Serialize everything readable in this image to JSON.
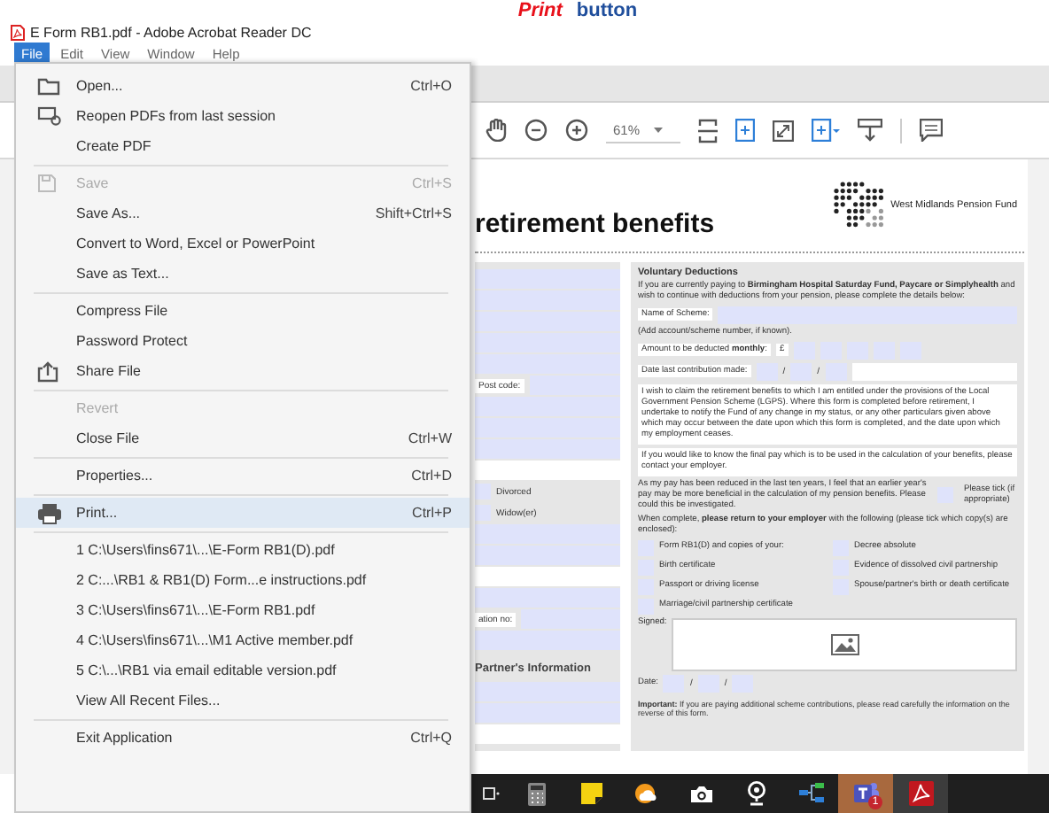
{
  "banner": [
    {
      "text": "Print",
      "kind": "emphasis"
    },
    {
      "text": "button",
      "kind": "plain"
    }
  ],
  "window": {
    "title": "E Form RB1.pdf - Adobe Acrobat Reader DC"
  },
  "menu_bar": [
    {
      "label": "File",
      "selected": true
    },
    {
      "label": "Edit",
      "selected": false
    },
    {
      "label": "View",
      "selected": false
    },
    {
      "label": "Window",
      "selected": false
    },
    {
      "label": "Help",
      "selected": false
    }
  ],
  "file_menu": [
    [
      {
        "label": "Open...",
        "shortcut": "Ctrl+O",
        "kind": "folder",
        "disabled": false,
        "highlighted": false
      },
      {
        "label": "Reopen PDFs from last session",
        "kind": "reopen",
        "disabled": false,
        "highlighted": false
      },
      {
        "label": "Create PDF",
        "disabled": false,
        "highlighted": false
      }
    ],
    [
      {
        "label": "Save",
        "shortcut": "Ctrl+S",
        "kind": "save",
        "disabled": true,
        "highlighted": false
      },
      {
        "label": "Save As...",
        "shortcut": "Shift+Ctrl+S",
        "disabled": false,
        "highlighted": false
      },
      {
        "label": "Convert to Word, Excel or PowerPoint",
        "disabled": false,
        "highlighted": false
      },
      {
        "label": "Save as Text...",
        "disabled": false,
        "highlighted": false
      }
    ],
    [
      {
        "label": "Compress File",
        "disabled": false,
        "highlighted": false
      },
      {
        "label": "Password Protect",
        "disabled": false,
        "highlighted": false
      },
      {
        "label": "Share File",
        "kind": "share",
        "disabled": false,
        "highlighted": false
      }
    ],
    [
      {
        "label": "Revert",
        "disabled": true,
        "highlighted": false
      },
      {
        "label": "Close File",
        "shortcut": "Ctrl+W",
        "disabled": false,
        "highlighted": false
      }
    ],
    [
      {
        "label": "Properties...",
        "shortcut": "Ctrl+D",
        "disabled": false,
        "highlighted": false
      }
    ],
    [
      {
        "label": "Print...",
        "shortcut": "Ctrl+P",
        "kind": "printer",
        "disabled": false,
        "highlighted": true
      }
    ],
    [
      {
        "label": "1 C:\\Users\\fins671\\...\\E-Form RB1(D).pdf",
        "disabled": false,
        "highlighted": false
      },
      {
        "label": "2 C:...\\RB1 & RB1(D) Form...e instructions.pdf",
        "disabled": false,
        "highlighted": false
      },
      {
        "label": "3 C:\\Users\\fins671\\...\\E-Form RB1.pdf",
        "disabled": false,
        "highlighted": false
      },
      {
        "label": "4 C:\\Users\\fins671\\...\\M1 Active member.pdf",
        "disabled": false,
        "highlighted": false
      },
      {
        "label": "5 C:\\...\\RB1 via email editable version.pdf",
        "disabled": false,
        "highlighted": false
      },
      {
        "label": "View All Recent Files...",
        "disabled": false,
        "highlighted": false
      }
    ],
    [
      {
        "label": "Exit Application",
        "shortcut": "Ctrl+Q",
        "disabled": false,
        "highlighted": false
      }
    ]
  ],
  "toolbar": {
    "zoom": "61%"
  },
  "document": {
    "title": "retirement benefits",
    "logo_text": "West Midlands Pension Fund",
    "left_rows": [
      {
        "kind": "field"
      },
      {
        "kind": "field"
      },
      {
        "kind": "field"
      },
      {
        "kind": "field"
      },
      {
        "kind": "field"
      },
      {
        "kind": "label_field",
        "label": "Post code:"
      },
      {
        "kind": "field"
      },
      {
        "kind": "field"
      },
      {
        "kind": "field"
      },
      {
        "kind": "blank"
      },
      {
        "kind": "option",
        "label": "Divorced",
        "checked": false
      },
      {
        "kind": "option",
        "label": "Widow(er)",
        "checked": false
      },
      {
        "kind": "field"
      },
      {
        "kind": "field"
      },
      {
        "kind": "blank"
      },
      {
        "kind": "field"
      },
      {
        "kind": "label_field",
        "label": "ation no:"
      },
      {
        "kind": "field"
      },
      {
        "kind": "heading",
        "label": "Partner's Information"
      },
      {
        "kind": "field"
      },
      {
        "kind": "field"
      },
      {
        "kind": "blank"
      }
    ],
    "heading": "Voluntary Deductions",
    "intro": "If you are currently paying to **Birmingham Hospital Saturday Fund, Paycare or Simplyhealth** and wish to continue with deductions from your pension, please complete the details below:",
    "scheme_label": "Name of Scheme:",
    "scheme_note": "(Add account/scheme number, if known).",
    "amount_label": "Amount to be deducted **monthly**:",
    "currency": "£",
    "contribution_label": "Date last contribution made:",
    "contribution_separators": [
      "/",
      "/"
    ],
    "declaration": [
      "I wish to claim the retirement benefits to which I am entitled under the provisions of the Local Government Pension Scheme (LGPS). Where this form is completed before retirement, I undertake to notify the Fund of any change in my status, or any other particulars given above which may occur between the date upon which this form is completed, and the date upon which my employment ceases.",
      "If you would like to know the final pay which is to be used in the calculation of your benefits, please contact your employer."
    ],
    "pay_note": "As my pay has been reduced in the last ten years, I feel that an earlier year's pay may be more beneficial in the calculation of my pension benefits. Please could this be investigated.",
    "tick_hint": "Please tick (if appropriate)",
    "pay_tick_checked": false,
    "return_note": "When complete, **please return to your employer** with the following (please tick which copy(s) are enclosed):",
    "enclosures": [
      {
        "label": "Form RB1(D) and copies of your:",
        "checked": false
      },
      {
        "label": "Decree absolute",
        "checked": false
      },
      {
        "label": "Birth certificate",
        "checked": false
      },
      {
        "label": "Evidence of dissolved civil partnership",
        "checked": false
      },
      {
        "label": "Passport or driving license",
        "checked": false
      },
      {
        "label": "Spouse/partner's birth or death certificate",
        "checked": false
      },
      {
        "label": "Marriage/civil partnership certificate",
        "checked": false
      }
    ],
    "signed_label": "Signed:",
    "date_label": "Date:",
    "date_separators": [
      "/",
      "/"
    ],
    "important": "**Important:** If you are paying additional scheme contributions, please read carefully the information on the reverse of this form."
  },
  "taskbar": [
    {
      "kind": "taskview",
      "flashing": false,
      "active": false
    },
    {
      "kind": "calculator",
      "flashing": false,
      "active": false
    },
    {
      "kind": "sticky",
      "flashing": false,
      "active": false
    },
    {
      "kind": "weather",
      "flashing": false,
      "active": false
    },
    {
      "kind": "camera",
      "flashing": false,
      "active": false
    },
    {
      "kind": "webcam",
      "flashing": false,
      "active": false
    },
    {
      "kind": "network",
      "flashing": false,
      "active": false
    },
    {
      "kind": "teams",
      "flashing": true,
      "active": false,
      "badge": "1"
    },
    {
      "kind": "acrobat",
      "flashing": false,
      "active": true
    }
  ]
}
